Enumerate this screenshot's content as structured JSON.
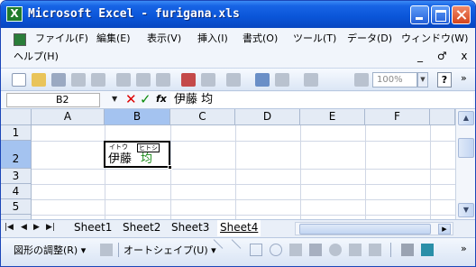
{
  "window": {
    "title": "Microsoft Excel - furigana.xls",
    "app_icon": "X"
  },
  "menu": {
    "items": [
      "ファイル(F)",
      "編集(E)",
      "表示(V)",
      "挿入(I)",
      "書式(O)",
      "ツール(T)",
      "データ(D)",
      "ウィンドウ(W)"
    ],
    "help": "ヘルプ(H)",
    "mdi_controls": "_ ♂ x"
  },
  "toolbar": {
    "zoom": "100%",
    "help_icon": "?",
    "overflow": "»"
  },
  "formula_bar": {
    "name_box": "B2",
    "fx": "fx",
    "content": "伊藤 均"
  },
  "grid": {
    "columns": [
      "A",
      "B",
      "C",
      "D",
      "E",
      "F"
    ],
    "rows": [
      "1",
      "2",
      "3",
      "4",
      "5"
    ],
    "selected_column": "B",
    "selected_row": "2",
    "cell_b2": {
      "furigana_1": "イトウ",
      "furigana_2": "ヒトシ",
      "text_1": "伊藤",
      "text_2": "均"
    }
  },
  "sheets": {
    "tabs": [
      "Sheet1",
      "Sheet2",
      "Sheet3",
      "Sheet4"
    ],
    "active": "Sheet4",
    "nav": [
      "|◀",
      "◀",
      "▶",
      "▶|"
    ]
  },
  "drawing_toolbar": {
    "draw_label": "図形の調整(R) ▾",
    "autoshape_label": "オートシェイプ(U) ▾",
    "overflow": "»"
  },
  "colors": {
    "title_bar": "#0a55d8",
    "selected_header": "#a4c3f0",
    "furigana_text": "#1a8a1a"
  }
}
